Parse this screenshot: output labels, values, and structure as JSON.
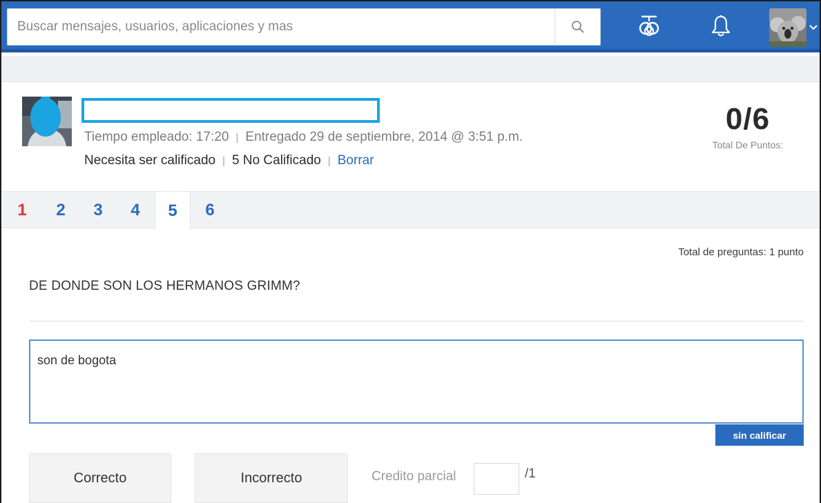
{
  "header": {
    "search_placeholder": "Buscar mensajes, usuarios, aplicaciones y mas",
    "icons": [
      "search-icon",
      "apps-icon",
      "bell-icon"
    ]
  },
  "submission": {
    "time_label": "Tiempo empleado: 17:20",
    "submitted_label": "Entregado 29 de septiembre, 2014 @ 3:51 p.m.",
    "status_label": "Necesita ser calificado",
    "ungraded_count_label": "5 No Calificado",
    "delete_link": "Borrar",
    "score": "0/6",
    "score_label": "Total De Puntos:"
  },
  "tabs": [
    {
      "label": "1",
      "state": "red"
    },
    {
      "label": "2",
      "state": "normal"
    },
    {
      "label": "3",
      "state": "normal"
    },
    {
      "label": "4",
      "state": "normal"
    },
    {
      "label": "5",
      "state": "active"
    },
    {
      "label": "6",
      "state": "normal"
    }
  ],
  "question": {
    "total_label": "Total de preguntas: 1 punto",
    "text": "DE DONDE SON LOS HERMANOS GRIMM?",
    "answer": "son de bogota",
    "ungraded_badge": "sin calificar"
  },
  "grading": {
    "correct_button": "Correcto",
    "incorrect_button": "Incorrecto",
    "partial_label": "Credito parcial",
    "partial_value": "",
    "partial_max": "/1"
  },
  "colors": {
    "topbar": "#2a6bbd",
    "accent": "#2a6bbd",
    "red_tab": "#d9363e",
    "name_box_border": "#1aa5e0"
  }
}
